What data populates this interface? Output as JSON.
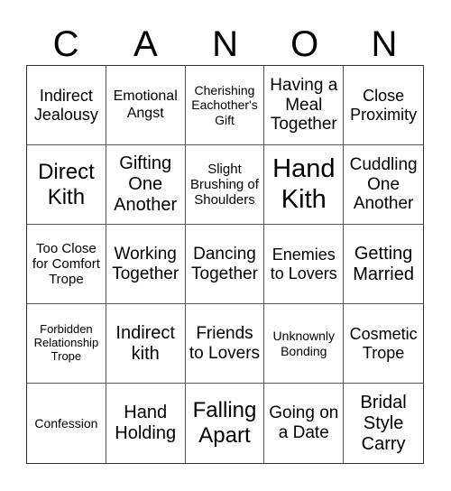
{
  "header": {
    "letters": [
      "C",
      "A",
      "N",
      "O",
      "N"
    ]
  },
  "cells": [
    "Indirect Jealousy",
    "Emotional Angst",
    "Cherishing Eachother's Gift",
    "Having a Meal Together",
    "Close Proximity",
    "Direct Kith",
    "Gifting One Another",
    "Slight Brushing of Shoulders",
    "Hand Kith",
    "Cuddling One Another",
    "Too Close for Comfort Trope",
    "Working Together",
    "Dancing Together",
    "Enemies to Lovers",
    "Getting Married",
    "Forbidden Relationship Trope",
    "Indirect kith",
    "Friends to Lovers",
    "Unknownly Bonding",
    "Cosmetic Trope",
    "Confession",
    "Hand Holding",
    "Falling Apart",
    "Going on a Date",
    "Bridal Style Carry"
  ]
}
